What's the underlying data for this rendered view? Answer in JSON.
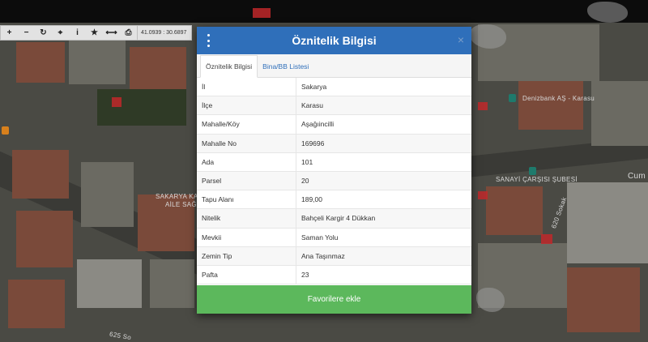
{
  "toolbar": {
    "buttons": [
      {
        "icon": "plus-icon",
        "glyph": "+"
      },
      {
        "icon": "minus-icon",
        "glyph": "−"
      },
      {
        "icon": "refresh-icon",
        "glyph": "↻"
      },
      {
        "icon": "crosshair-icon",
        "glyph": "⌖"
      },
      {
        "icon": "info-icon",
        "glyph": "i"
      },
      {
        "icon": "star-icon",
        "glyph": "★"
      },
      {
        "icon": "measure-icon",
        "glyph": "⟷"
      },
      {
        "icon": "print-icon",
        "glyph": "⎙"
      }
    ],
    "coordinates": "41.0939 : 30.6897"
  },
  "map_labels": {
    "bank": "Denizbank AŞ - Karasu",
    "branch": "SANAYİ ÇARŞISI ŞUBESİ",
    "street_620": "620 Sokak",
    "sakarya": "SAKARYA KAR",
    "aile": "AİLE SAĞ",
    "cumhuriyet": "Cum",
    "street_625": "625 So"
  },
  "modal": {
    "title": "Öznitelik Bilgisi",
    "close": "×",
    "tabs": [
      {
        "label": "Öznitelik Bilgisi",
        "active": true
      },
      {
        "label": "Bina/BB Listesi",
        "active": false
      }
    ],
    "rows": [
      {
        "key": "İl",
        "value": "Sakarya"
      },
      {
        "key": "İlçe",
        "value": "Karasu"
      },
      {
        "key": "Mahalle/Köy",
        "value": "Aşağıincilli"
      },
      {
        "key": "Mahalle No",
        "value": "169696"
      },
      {
        "key": "Ada",
        "value": "101"
      },
      {
        "key": "Parsel",
        "value": "20"
      },
      {
        "key": "Tapu Alanı",
        "value": "189,00"
      },
      {
        "key": "Nitelik",
        "value": "Bahçeli Kargir 4 Dükkan"
      },
      {
        "key": "Mevkii",
        "value": "Saman Yolu"
      },
      {
        "key": "Zemin Tip",
        "value": "Ana Taşınmaz"
      },
      {
        "key": "Pafta",
        "value": "23"
      }
    ],
    "favorite_button": "Favorilere ekle"
  },
  "colors": {
    "header": "#2f6fba",
    "favorite": "#5cb85c",
    "toolbar": "#e2e2e2"
  }
}
